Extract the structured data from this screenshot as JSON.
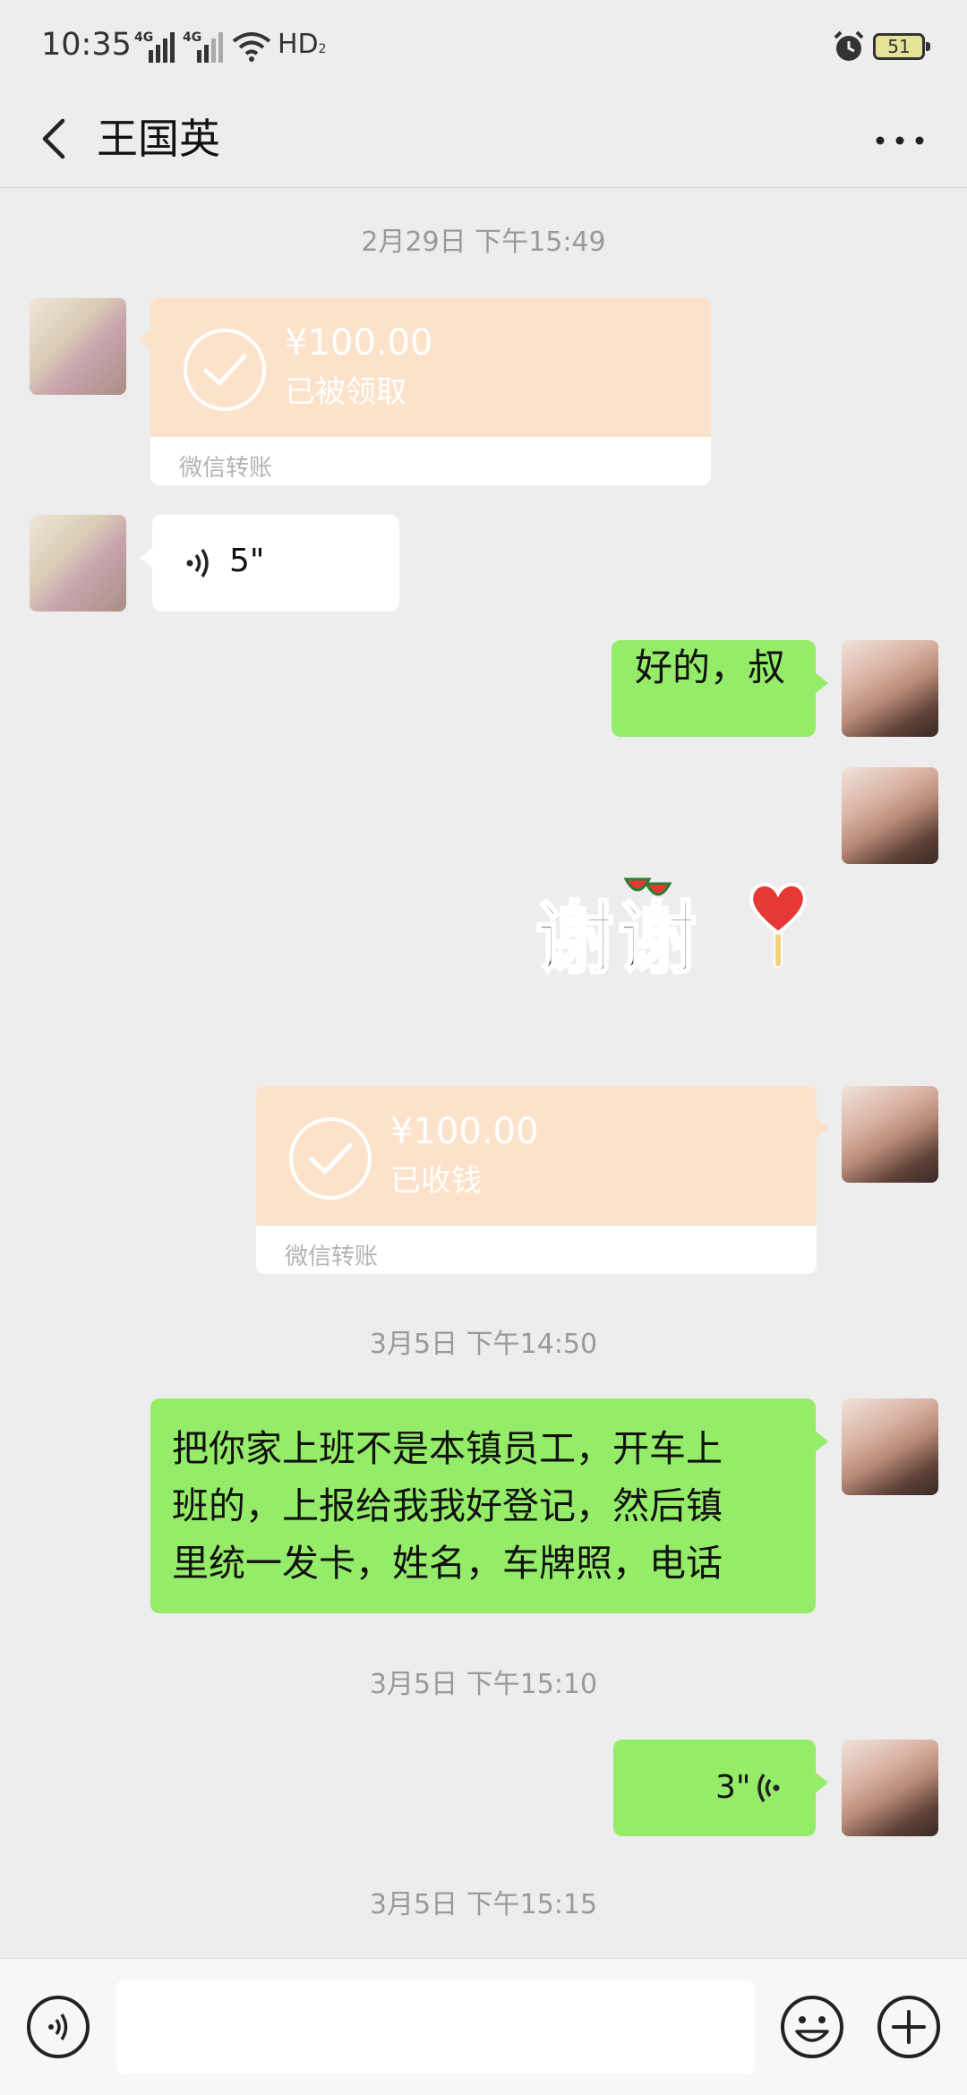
{
  "status_bar": {
    "time": "10:35",
    "network_1": "4G",
    "network_2": "4G",
    "hd": "HD",
    "hd_sub": "2",
    "battery": "51"
  },
  "header": {
    "title": "王国英"
  },
  "messages": {
    "ts_1": "2月29日 下午15:49",
    "transfer_1": {
      "amount": "¥100.00",
      "status": "已被领取",
      "footer": "微信转账"
    },
    "voice_1": {
      "duration": "5\""
    },
    "text_1": "好的，叔",
    "sticker_text": "谢谢",
    "transfer_2": {
      "amount": "¥100.00",
      "status": "已收钱",
      "footer": "微信转账"
    },
    "ts_2": "3月5日 下午14:50",
    "text_2_line1": "把你家上班不是本镇员工，开车上",
    "text_2_line2": "班的，上报给我我好登记，然后镇",
    "text_2_line3": "里统一发卡，姓名，车牌照，电话",
    "ts_3": "3月5日 下午15:10",
    "voice_2": {
      "duration": "3\""
    },
    "ts_4": "3月5日 下午15:15"
  },
  "colors": {
    "bubble_green": "#95ec69",
    "transfer_bg": "#fde2cb",
    "background": "#ededed"
  }
}
